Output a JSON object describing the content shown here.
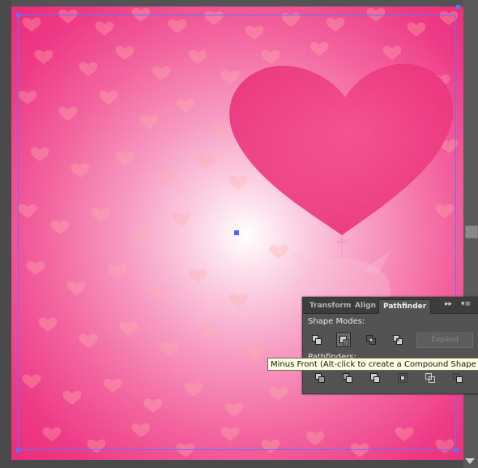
{
  "colors": {
    "artboard_bg": "#e92676",
    "glow_center": "#ffffff",
    "selection": "#4e7cff",
    "panel_bg": "#535353",
    "tooltip_bg": "#ffffe1"
  },
  "panel": {
    "tabs": [
      {
        "label": "Transform"
      },
      {
        "label": "Align"
      },
      {
        "label": "Pathfinder",
        "active": true
      }
    ],
    "more_icon": "double-chevron-right-icon",
    "menu_icon": "panel-menu-icon",
    "shape_modes_label": "Shape Modes:",
    "expand_label": "Expand",
    "pathfinders_label": "Pathfinders:"
  },
  "tooltip": {
    "text": "Minus Front (Alt-click to create a Compound Shape and su"
  }
}
